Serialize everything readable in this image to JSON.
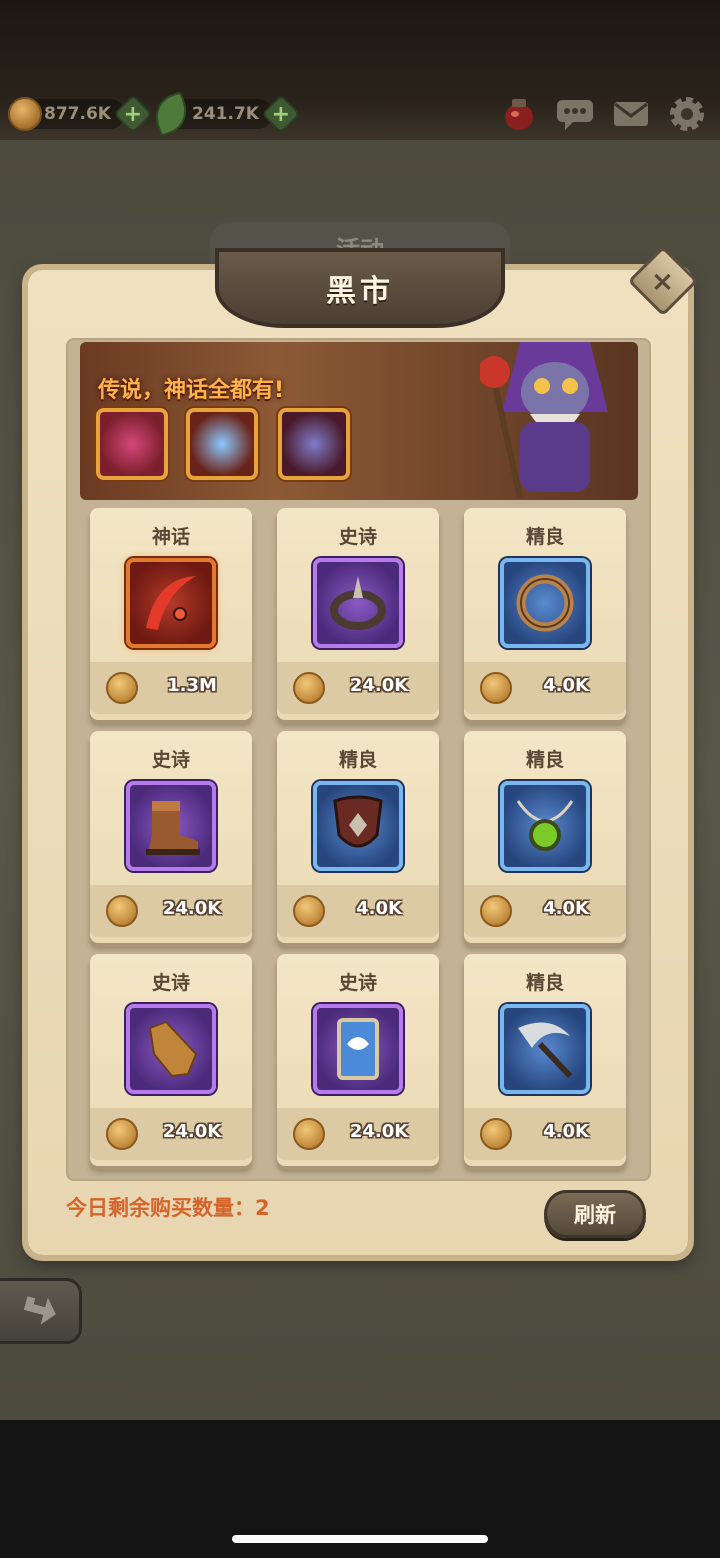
{
  "resources": {
    "gold": "877.6K",
    "gems": "241.7K",
    "plus": "+"
  },
  "top_icons": [
    "potion-icon",
    "chat-icon",
    "mail-icon",
    "settings-icon"
  ],
  "tab_behind": "活动",
  "panel": {
    "title": "黑市",
    "close": "×"
  },
  "banner": {
    "text": "传说，神话全都有!"
  },
  "items": [
    {
      "rarity": "神话",
      "price": "1.3M",
      "tier": "mythic",
      "icon": "sword-icon"
    },
    {
      "rarity": "史诗",
      "price": "24.0K",
      "tier": "epic",
      "icon": "ring-icon"
    },
    {
      "rarity": "精良",
      "price": "4.0K",
      "tier": "fine",
      "icon": "ring-icon"
    },
    {
      "rarity": "史诗",
      "price": "24.0K",
      "tier": "epic",
      "icon": "boots-icon"
    },
    {
      "rarity": "精良",
      "price": "4.0K",
      "tier": "fine",
      "icon": "shield-icon"
    },
    {
      "rarity": "精良",
      "price": "4.0K",
      "tier": "fine",
      "icon": "amulet-icon"
    },
    {
      "rarity": "史诗",
      "price": "24.0K",
      "tier": "epic",
      "icon": "gloves-icon"
    },
    {
      "rarity": "史诗",
      "price": "24.0K",
      "tier": "epic",
      "icon": "shield-icon"
    },
    {
      "rarity": "精良",
      "price": "4.0K",
      "tier": "fine",
      "icon": "scythe-icon"
    }
  ],
  "footer": {
    "remaining": "今日剩余购买数量：2",
    "refresh": "刷新"
  }
}
